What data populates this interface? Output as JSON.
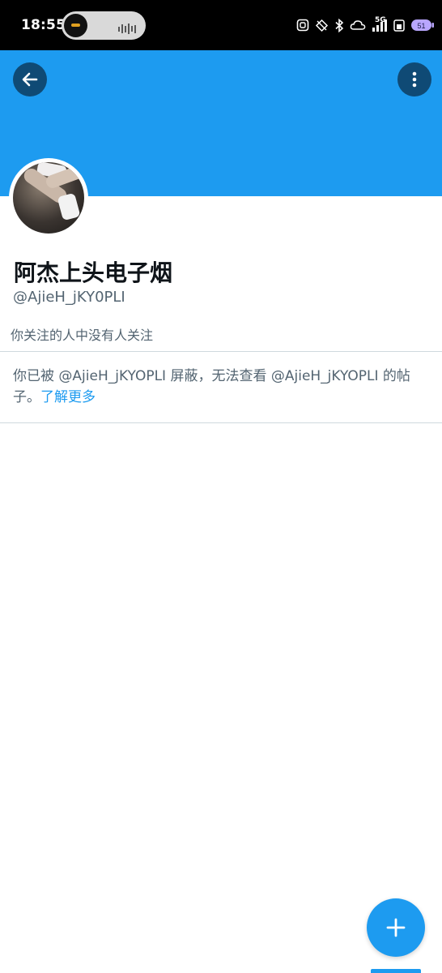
{
  "status_bar": {
    "time": "18:55",
    "network": "5G",
    "icons": [
      "nfc-icon",
      "location-off-icon",
      "bluetooth-icon",
      "cloud-icon",
      "signal-icon",
      "wifi-icon",
      "battery-icon"
    ]
  },
  "header": {
    "back_icon": "arrow-left-icon",
    "more_icon": "more-vertical-icon",
    "banner_color": "#1d9bf0"
  },
  "profile": {
    "display_name": "阿杰上头电子烟",
    "handle": "@AjieH_jKY0PLI",
    "followers_you_follow": "你关注的人中没有人关注"
  },
  "blocked_notice": {
    "text": "你已被 @AjieH_jKYOPLI 屏蔽，无法查看 @AjieH_jKYOPLI 的帖子。",
    "link_label": "了解更多"
  },
  "fab": {
    "icon": "plus-icon",
    "color": "#1d9bf0"
  }
}
